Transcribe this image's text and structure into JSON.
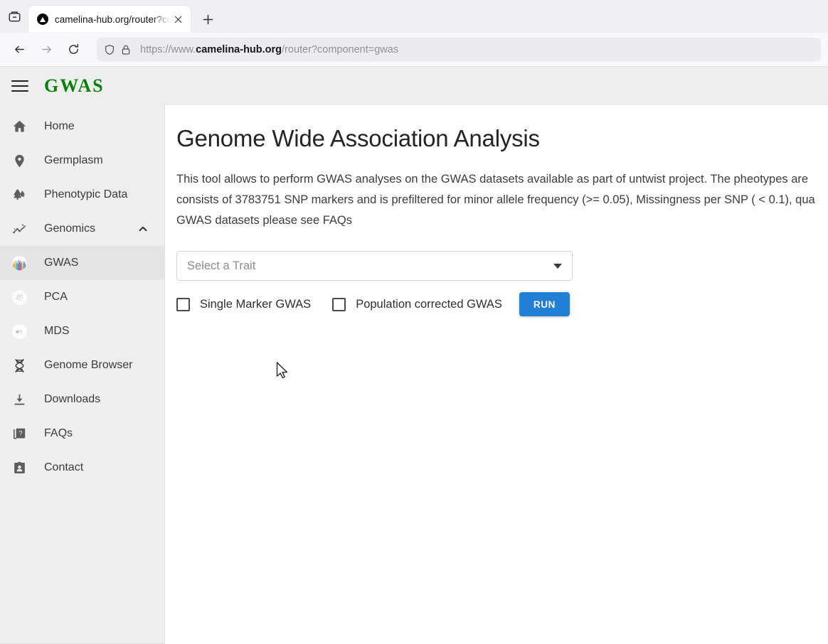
{
  "browser": {
    "tab": {
      "title": "camelina-hub.org/router?co",
      "favicon_name": "site-favicon",
      "close_label": "×"
    },
    "newtab_label": "+",
    "toolbar": {
      "back_label": "Back",
      "forward_label": "Forward",
      "reload_label": "Reload",
      "tab_list_label": "List all tabs"
    },
    "url": {
      "scheme": "https://www.",
      "host": "camelina-hub.org",
      "path": "/router?component=gwas",
      "full": "https://www.camelina-hub.org/router?component=gwas",
      "shield_icon": "shield-icon",
      "lock_icon": "lock-icon"
    }
  },
  "app": {
    "brand": "GWAS",
    "menu_icon": "hamburger-menu-icon"
  },
  "sidebar": {
    "items": [
      {
        "label": "Home",
        "icon": "home-icon",
        "active": false,
        "expandable": false
      },
      {
        "label": "Germplasm",
        "icon": "map-pin-icon",
        "active": false,
        "expandable": false
      },
      {
        "label": "Phenotypic Data",
        "icon": "forest-trees-icon",
        "active": false,
        "expandable": false
      },
      {
        "label": "Genomics",
        "icon": "chart-sparkle-icon",
        "active": false,
        "expandable": true,
        "expanded": true
      },
      {
        "label": "GWAS",
        "icon": "manhattan-plot-thumb",
        "active": true,
        "expandable": false
      },
      {
        "label": "PCA",
        "icon": "pca-plot-thumb",
        "active": false,
        "expandable": false
      },
      {
        "label": "MDS",
        "icon": "mds-plot-thumb",
        "active": false,
        "expandable": false
      },
      {
        "label": "Genome Browser",
        "icon": "dna-helix-icon",
        "active": false,
        "expandable": false
      },
      {
        "label": "Downloads",
        "icon": "download-icon",
        "active": false,
        "expandable": false
      },
      {
        "label": "FAQs",
        "icon": "question-pages-icon",
        "active": false,
        "expandable": false
      },
      {
        "label": "Contact",
        "icon": "contact-card-icon",
        "active": false,
        "expandable": false
      }
    ]
  },
  "main": {
    "title": "Genome Wide Association Analysis",
    "intro_line1": "This tool allows to perform GWAS analyses on the GWAS datasets available as part of untwist project. The pheotypes are",
    "intro_line2": "consists of 3783751 SNP markers and is prefiltered for minor allele frequency (>= 0.05), Missingness per SNP ( < 0.1), qua",
    "intro_line3": "GWAS datasets please see FAQs",
    "trait_select": {
      "placeholder": "Select a Trait",
      "value": "",
      "caret_icon": "chevron-down-icon"
    },
    "checkboxes": [
      {
        "label": "Single Marker GWAS",
        "checked": false
      },
      {
        "label": "Population corrected GWAS",
        "checked": false
      }
    ],
    "run_button": "RUN"
  },
  "colors": {
    "brand_green": "#098109",
    "run_blue": "#2180d6",
    "sidebar_bg": "#efefef",
    "active_item_bg": "#e4e4e4",
    "appbar_bg": "#eeeeee"
  }
}
